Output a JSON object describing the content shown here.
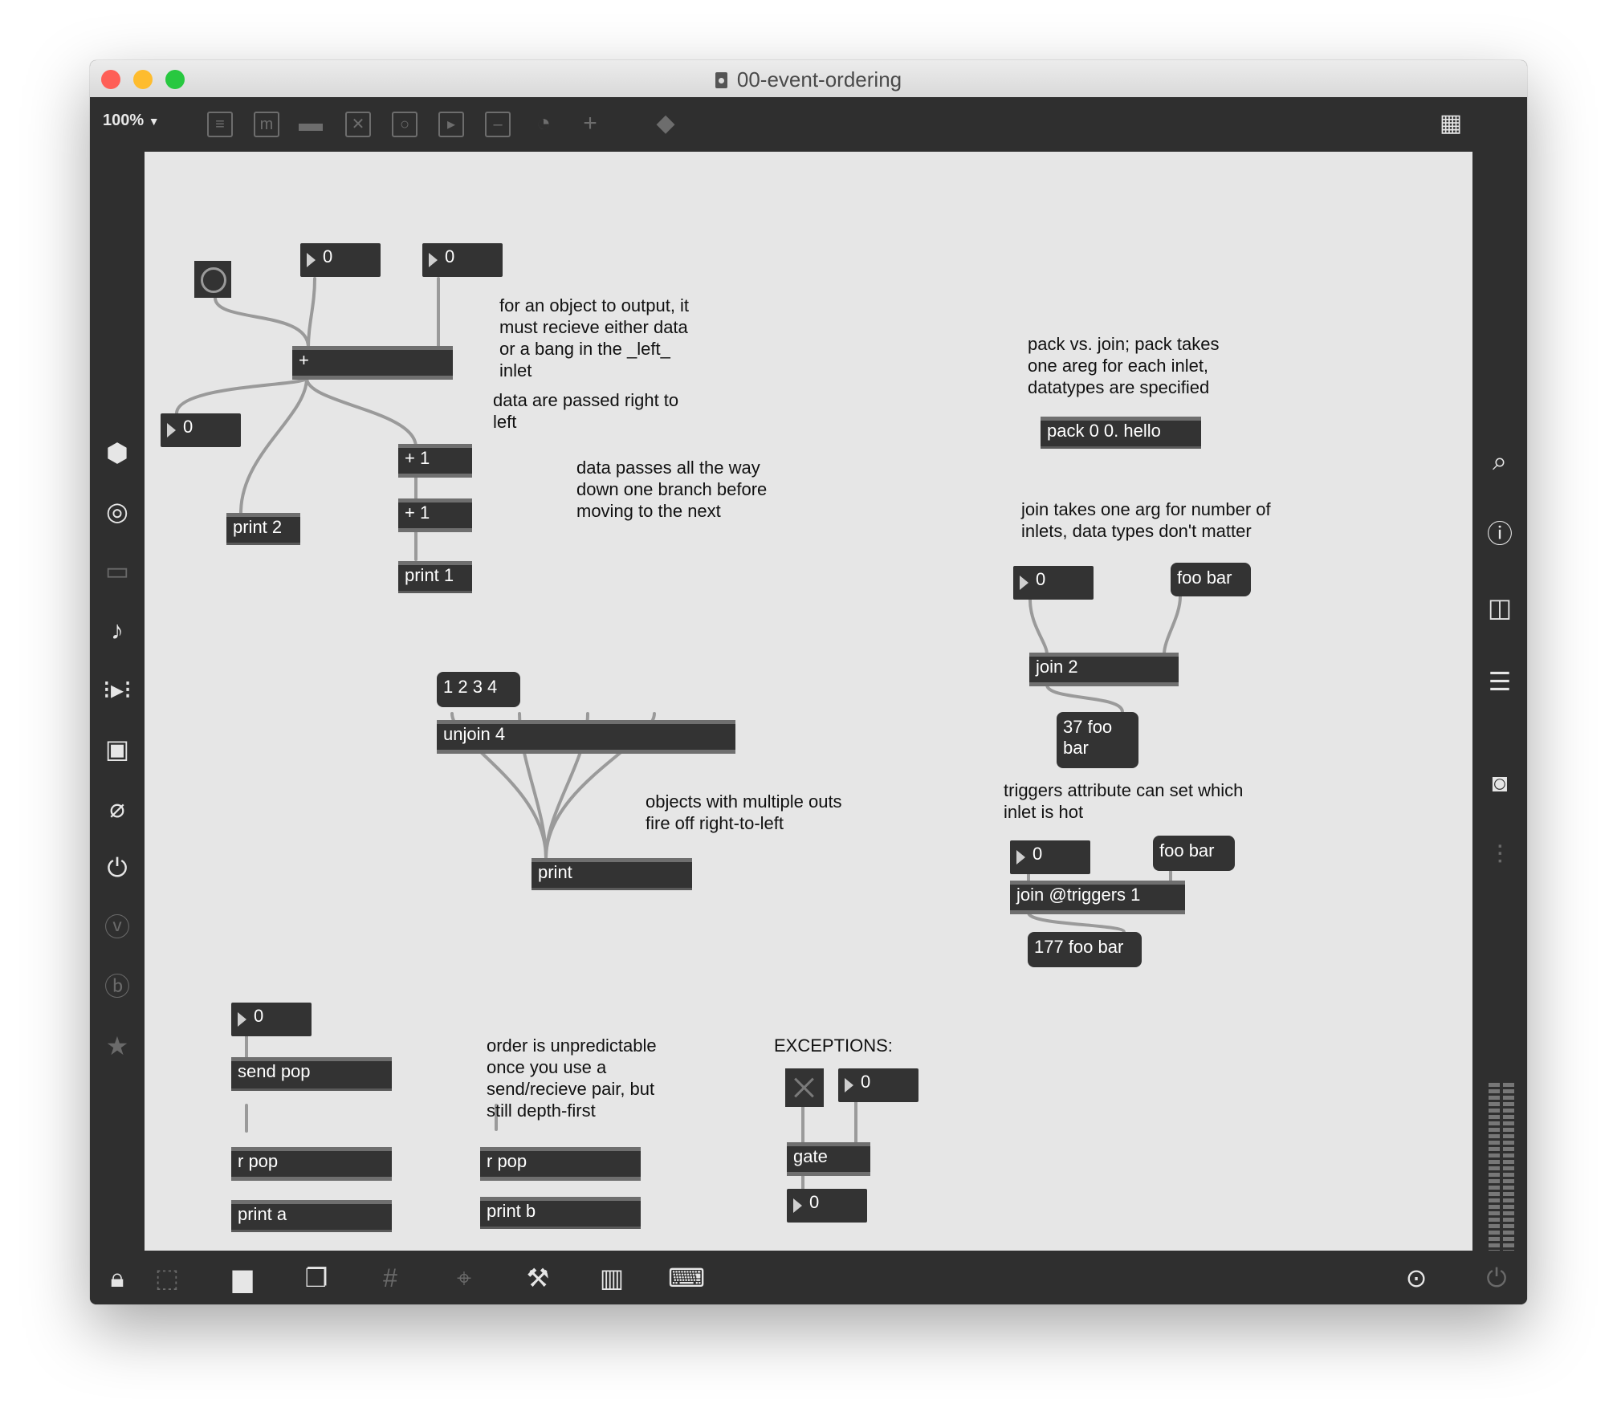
{
  "window": {
    "title": "00-event-ordering"
  },
  "toolbar": {
    "zoom": "100%"
  },
  "colors": {
    "canvas": "#e6e6e6",
    "object": "#333333",
    "chrome": "#2f2f2f",
    "close": "#fe5f57",
    "minimize": "#febc2e",
    "zoom": "#28c840"
  },
  "icons": {
    "left_sidebar": [
      "cube-icon",
      "target-icon",
      "media-icon",
      "music-note-icon",
      "step-icon",
      "image-icon",
      "paperclip-icon",
      "plug-icon",
      "v-icon",
      "b-icon",
      "star-icon"
    ],
    "right_sidebar": [
      "search-icon",
      "info-icon",
      "columns-icon",
      "list-icon",
      "camera-icon",
      "sliders-icon"
    ],
    "bottom_bar": [
      "lock-icon",
      "edit-icon",
      "presentation-icon",
      "windows-icon",
      "grid-icon",
      "pin-icon",
      "wrench-icon",
      "piano-icon",
      "keyboard-icon",
      "play-icon",
      "power-icon"
    ]
  },
  "patch": {
    "num_top_a": "0",
    "num_top_b": "0",
    "plus_obj": "+",
    "num_left": "0",
    "plus1_a": "+ 1",
    "plus1_b": "+ 1",
    "print2": "print 2",
    "print1": "print 1",
    "comment_output": "for an object to output, it\nmust recieve either data\nor a bang in the _left_\ninlet",
    "comment_right_to_left": "data are passed right to\nleft",
    "comment_branch": "data passes all the way\ndown one branch before\nmoving to the next",
    "comment_pack": "pack vs. join; pack takes\none areg for each inlet,\ndatatypes are specified",
    "pack_obj": "pack 0 0. hello",
    "comment_join": "join takes one arg for number of\ninlets, data types don't matter",
    "num_join2": "0",
    "msg_foobar1": "foo bar",
    "join2": "join 2",
    "msg_37": "37 foo\nbar",
    "msg_1234": "1 2 3 4",
    "unjoin": "unjoin 4",
    "comment_multiple_outs": "objects with multiple outs\nfire off right-to-left",
    "print_obj": "print",
    "comment_triggers": "triggers attribute can set which\ninlet is hot",
    "num_triggers": "0",
    "msg_foobar2": "foo bar",
    "join_triggers": "join @triggers 1",
    "msg_177": "177 foo bar",
    "num_send": "0",
    "send_pop": "send pop",
    "r_pop_a": "r pop",
    "print_a": "print a",
    "comment_order": "order is unpredictable\nonce you use a\nsend/recieve pair, but\nstill depth-first",
    "r_pop_b": "r pop",
    "print_b": "print b",
    "comment_exceptions": "EXCEPTIONS:",
    "num_gate_in": "0",
    "gate": "gate",
    "num_gate_out": "0"
  }
}
